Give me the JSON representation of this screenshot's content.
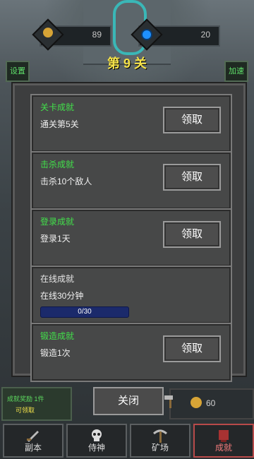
{
  "header": {
    "coins": "89",
    "gems": "20",
    "level_title": "第 9 关",
    "settings_label": "设置",
    "speed_label": "加速"
  },
  "modal": {
    "cards": [
      {
        "title": "关卡成就",
        "desc": "通关第5关",
        "button": "领取"
      },
      {
        "title": "击杀成就",
        "desc": "击杀10个敌人",
        "button": "领取"
      },
      {
        "title": "登录成就",
        "desc": "登录1天",
        "button": "领取"
      },
      {
        "title": "在线成就",
        "desc": "在线30分钟",
        "progress_text": "0/30",
        "progress": 0
      },
      {
        "title": "锻造成就",
        "desc": "锻造1次",
        "button": "领取"
      }
    ],
    "close_label": "关闭"
  },
  "achievement_notice": {
    "line1": "成就奖励 1件",
    "line2": "可领取"
  },
  "shop": {
    "price": "60"
  },
  "nav": {
    "items": [
      {
        "label": "副本"
      },
      {
        "label": "侍神"
      },
      {
        "label": "矿场"
      },
      {
        "label": "成就"
      }
    ]
  },
  "colors": {
    "accent_green": "#42e04a",
    "title_yellow": "#f4e24a",
    "progress_blue": "#1b2a6b"
  }
}
